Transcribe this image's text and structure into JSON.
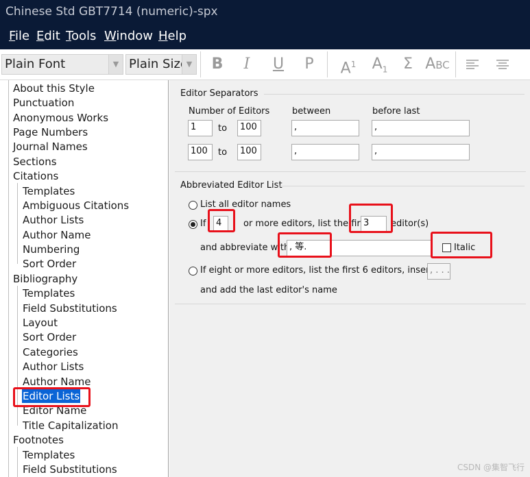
{
  "window": {
    "title": "Chinese Std GBT7714 (numeric)-spx"
  },
  "menu": [
    "File",
    "Edit",
    "Tools",
    "Window",
    "Help"
  ],
  "toolbar": {
    "font_combo": "Plain Font",
    "size_combo": "Plain Size",
    "bold": "B",
    "italic": "I",
    "underline": "U",
    "plain": "P",
    "superscript": "A",
    "superscript_mark": "1",
    "subscript": "A",
    "subscript_mark": "1",
    "symbol": "Σ",
    "smallcaps": "Abc"
  },
  "tree": [
    {
      "label": "About this Style"
    },
    {
      "label": "Punctuation"
    },
    {
      "label": "Anonymous Works"
    },
    {
      "label": "Page Numbers"
    },
    {
      "label": "Journal Names"
    },
    {
      "label": "Sections"
    },
    {
      "label": "Citations"
    },
    {
      "label": "Templates"
    },
    {
      "label": "Ambiguous Citations"
    },
    {
      "label": "Author Lists"
    },
    {
      "label": "Author Name"
    },
    {
      "label": "Numbering"
    },
    {
      "label": "Sort Order"
    },
    {
      "label": "Bibliography"
    },
    {
      "label": "Templates"
    },
    {
      "label": "Field Substitutions"
    },
    {
      "label": "Layout"
    },
    {
      "label": "Sort Order"
    },
    {
      "label": "Categories"
    },
    {
      "label": "Author Lists"
    },
    {
      "label": "Author Name"
    },
    {
      "label": "Editor Lists"
    },
    {
      "label": "Editor Name"
    },
    {
      "label": "Title Capitalization"
    },
    {
      "label": "Footnotes"
    },
    {
      "label": "Templates"
    },
    {
      "label": "Field Substitutions"
    }
  ],
  "separators": {
    "title": "Editor Separators",
    "col_number": "Number of Editors",
    "col_between": "between",
    "col_before_last": "before last",
    "to_label": "to",
    "rows": [
      {
        "from": "1",
        "to": "100",
        "between": ",",
        "before_last": ","
      },
      {
        "from": "100",
        "to": "100",
        "between": ",",
        "before_last": ","
      }
    ]
  },
  "abbreviated": {
    "title": "Abbreviated Editor List",
    "option_list_all": "List all editor names",
    "option_if": "If",
    "if_count": "4",
    "or_more_text": "or more editors, list the first",
    "first_count": "3",
    "editors_suffix": "editor(s)",
    "abbreviate_label": "and abbreviate with:",
    "abbreviate_value": ", 等.",
    "italic_label": "Italic",
    "option_eight": "If eight or more editors, list the first 6 editors, insert:",
    "insert_value": ", . . .",
    "add_last": "and add the last editor's name"
  },
  "watermark": "CSDN @集智飞行"
}
